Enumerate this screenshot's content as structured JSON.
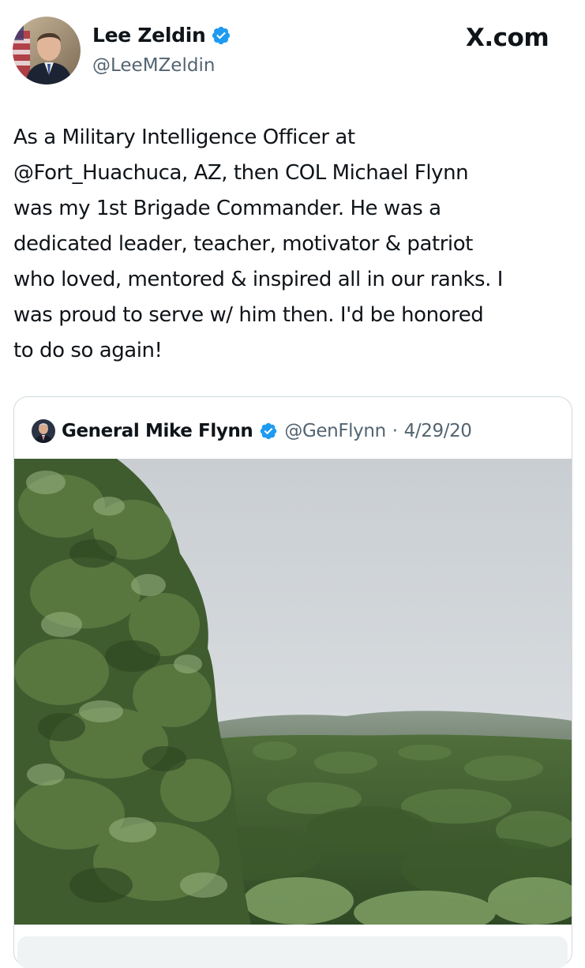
{
  "tweet": {
    "author": {
      "display_name": "Lee Zeldin",
      "handle": "@LeeMZeldin",
      "verified_icon": "verified-badge-icon"
    },
    "brand": "X.com",
    "text": "As a Military Intelligence Officer at\n@Fort_Huachuca, AZ, then COL Michael Flynn\nwas my 1st Brigade Commander. He was a\ndedicated leader, teacher, motivator & patriot\nwho loved, mentored & inspired all in our ranks. I\nwas proud to serve w/ him then. I'd be honored\nto do so again!"
  },
  "quoted_tweet": {
    "display_name": "General Mike Flynn",
    "handle": "@GenFlynn",
    "separator": "·",
    "date": "4/29/20",
    "media": {
      "kind": "video-still",
      "description_icon": "landscape-media"
    }
  },
  "colors": {
    "text_primary": "#0f1419",
    "text_secondary": "#536471",
    "verified_blue": "#1d9bf0",
    "border": "#cfd9de"
  }
}
